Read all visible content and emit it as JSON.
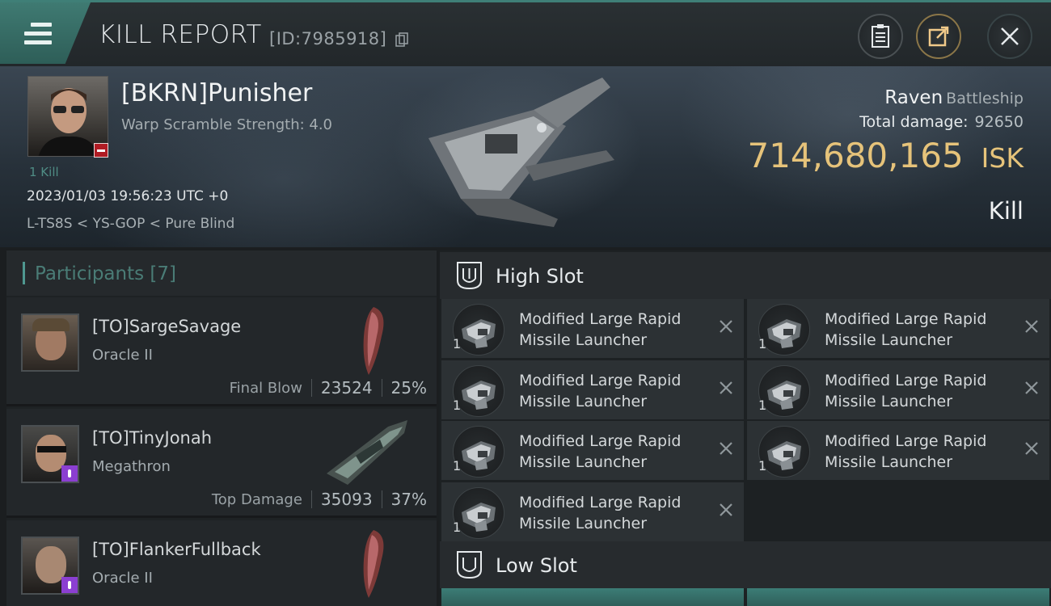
{
  "header": {
    "title": "KILL REPORT",
    "report_id": "[ID:7985918]",
    "icons": [
      "menu-icon",
      "copy-icon",
      "clipboard-icon",
      "share-icon",
      "close-icon"
    ],
    "accent_color": "#3f7f77"
  },
  "victim": {
    "name": "[BKRN]Punisher",
    "warp_scramble": "Warp Scramble Strength: 4.0",
    "kill_count": "1 Kill",
    "datetime": "2023/01/03 19:56:23 UTC +0",
    "location": "L-TS8S < YS-GOP < Pure Blind",
    "ship_name": "Raven",
    "ship_class": "Battleship",
    "total_damage_label": "Total damage:",
    "total_damage": "92650",
    "isk_value": "714,680,165",
    "isk_unit": "ISK",
    "report_type": "Kill",
    "isk_color": "#e6c37a"
  },
  "participants": {
    "header": "Participants [7]",
    "list": [
      {
        "name": "[TO]SargeSavage",
        "ship": "Oracle II",
        "role": "Final Blow",
        "damage": "23524",
        "percent": "25%"
      },
      {
        "name": "[TO]TinyJonah",
        "ship": "Megathron",
        "role": "Top Damage",
        "damage": "35093",
        "percent": "37%"
      },
      {
        "name": "[TO]FlankerFullback",
        "ship": "Oracle II"
      }
    ]
  },
  "fitting": {
    "high_slot_label": "High Slot",
    "low_slot_label": "Low Slot",
    "high_modules": [
      {
        "line1": "Modified Large Rapid",
        "line2": "Missile Launcher",
        "qty": "1"
      },
      {
        "line1": "Modified Large Rapid",
        "line2": "Missile Launcher",
        "qty": "1"
      },
      {
        "line1": "Modified Large Rapid",
        "line2": "Missile Launcher",
        "qty": "1"
      },
      {
        "line1": "Modified Large Rapid",
        "line2": "Missile Launcher",
        "qty": "1"
      },
      {
        "line1": "Modified Large Rapid",
        "line2": "Missile Launcher",
        "qty": "1"
      },
      {
        "line1": "Modified Large Rapid",
        "line2": "Missile Launcher",
        "qty": "1"
      },
      {
        "line1": "Modified Large Rapid",
        "line2": "Missile Launcher",
        "qty": "1"
      }
    ]
  }
}
